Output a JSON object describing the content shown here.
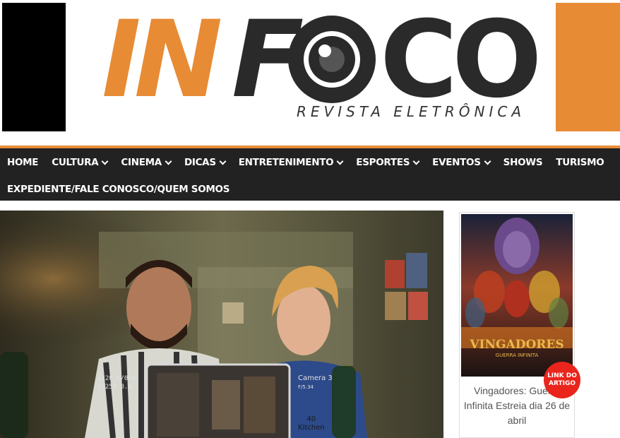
{
  "header": {
    "logo_part1": "IN",
    "logo_part2": "F",
    "logo_part3": "CO",
    "tagline": "REVISTA ELETRÔNICA"
  },
  "nav": {
    "row1": [
      {
        "label": "HOME",
        "dropdown": false
      },
      {
        "label": "CULTURA",
        "dropdown": true
      },
      {
        "label": "CINEMA",
        "dropdown": true
      },
      {
        "label": "DICAS",
        "dropdown": true
      },
      {
        "label": "ENTRETENIMENTO",
        "dropdown": true
      },
      {
        "label": "ESPORTES",
        "dropdown": true
      },
      {
        "label": "EVENTOS",
        "dropdown": true
      },
      {
        "label": "SHOWS",
        "dropdown": false
      },
      {
        "label": "TURISMO",
        "dropdown": false
      }
    ],
    "row2": [
      {
        "label": "EXPEDIENTE/FALE CONOSCO/QUEM SOMOS",
        "dropdown": false
      }
    ]
  },
  "hero": {
    "overlay_left": "1/20 K/060",
    "overlay_left2": "1/250  8.0",
    "overlay_right": "Camera 3",
    "overlay_right2": "F/5.34",
    "overlay_center_num": "40",
    "overlay_center_label": "Kitchen"
  },
  "sidebar": {
    "poster_title": "VINGADORES",
    "poster_subtitle": "GUERRA INFINITA",
    "caption": "Vingadores: Guerra Infinita Estreia dia 26 de abril",
    "badge_line1": "LINK DO",
    "badge_line2": "ARTIGO"
  },
  "colors": {
    "accent": "#e88b35",
    "nav_bg": "#222222",
    "badge": "#e9251c"
  }
}
